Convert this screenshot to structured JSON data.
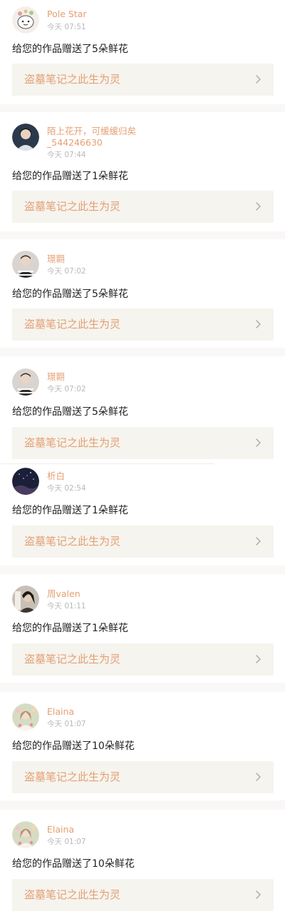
{
  "colors": {
    "accent": "#e59f73",
    "timestamp": "#b9b9b9",
    "card_background": "#ffffff",
    "page_background": "#faf7f7",
    "work_background": "#f5f4ee"
  },
  "notifications": [
    {
      "avatar_icon": "cartoon-bear-avatar-icon",
      "user": "Pole Star",
      "time": "今天 07:51",
      "message": "给您的作品赠送了5朵鲜花",
      "work_title": "盗墓笔记之此生为灵"
    },
    {
      "avatar_icon": "person-portrait-avatar-icon",
      "user": "陌上花开，可缓缓归矣_544246630",
      "user_line1": "陌上花开，可缓缓归矣",
      "user_line2": "_544246630",
      "time": "今天 07:44",
      "message": "给您的作品赠送了1朵鲜花",
      "work_title": "盗墓笔记之此生为灵"
    },
    {
      "avatar_icon": "person-striped-shirt-avatar-icon",
      "user": "璟翾",
      "time": "今天 07:02",
      "message": "给您的作品赠送了5朵鲜花",
      "work_title": "盗墓笔记之此生为灵"
    },
    {
      "avatar_icon": "person-striped-shirt-avatar-icon",
      "user": "璟翾",
      "time": "今天 07:02",
      "message": "给您的作品赠送了5朵鲜花",
      "work_title": "盗墓笔记之此生为灵"
    },
    {
      "avatar_icon": "night-sky-avatar-icon",
      "user": "析白",
      "time": "今天 02:54",
      "message": "给您的作品赠送了1朵鲜花",
      "work_title": "盗墓笔记之此生为灵"
    },
    {
      "avatar_icon": "person-profile-avatar-icon",
      "user": "周valen",
      "time": "今天 01:11",
      "message": "给您的作品赠送了1朵鲜花",
      "work_title": "盗墓笔记之此生为灵"
    },
    {
      "avatar_icon": "girl-flowers-avatar-icon",
      "user": "Elaina",
      "time": "今天 01:07",
      "message": "给您的作品赠送了10朵鲜花",
      "work_title": "盗墓笔记之此生为灵"
    },
    {
      "avatar_icon": "girl-flowers-avatar-icon",
      "user": "Elaina",
      "time": "今天 01:07",
      "message": "给您的作品赠送了10朵鲜花",
      "work_title": "盗墓笔记之此生为灵"
    }
  ]
}
